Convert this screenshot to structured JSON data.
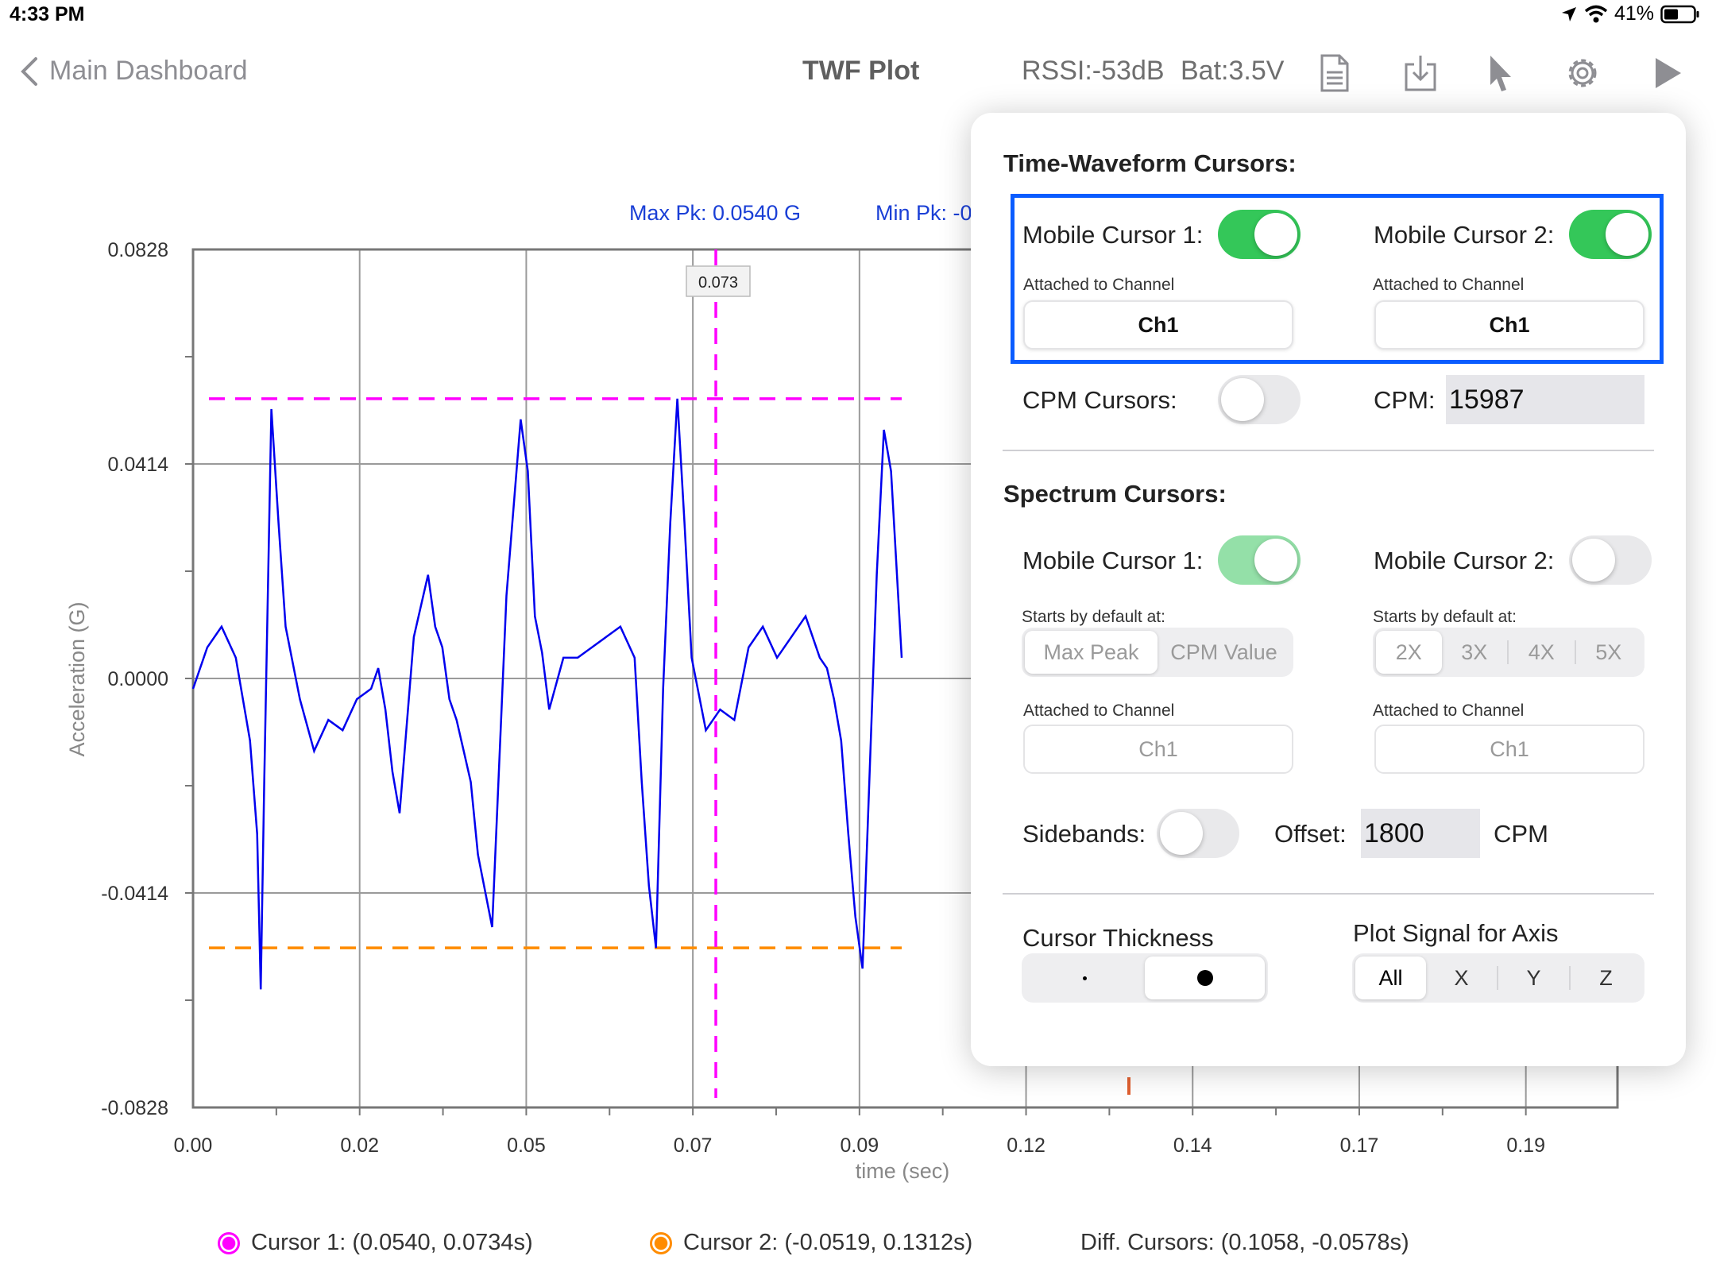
{
  "status_bar": {
    "time": "4:33 PM",
    "battery": "41%"
  },
  "nav": {
    "back_label": "Main Dashboard",
    "title": "TWF Plot",
    "rssi": "RSSI:-53dB",
    "battery": "Bat:3.5V",
    "tools": [
      "report-icon",
      "download-icon",
      "cursor-icon",
      "gear-icon",
      "play-icon"
    ]
  },
  "chart": {
    "max_pk": "Max Pk: 0.0540 G",
    "min_pk": "Min Pk: -0",
    "cursor_tag": "0.073",
    "y_axis_label": "Acceleration (G)",
    "x_axis_label": "time (sec)",
    "y_tick_labels": [
      "0.0828",
      "0.0414",
      "0.0000",
      "-0.0414",
      "-0.0828"
    ],
    "x_tick_labels": [
      "0.00",
      "0.02",
      "0.05",
      "0.07",
      "0.09",
      "0.12",
      "0.14",
      "0.17",
      "0.19"
    ]
  },
  "chart_data": {
    "type": "line",
    "xlabel": "time (sec)",
    "ylabel": "Acceleration (G)",
    "xlim": [
      0,
      0.2
    ],
    "ylim": [
      -0.0828,
      0.0828
    ],
    "series": [
      {
        "color": "#0000ee",
        "x": [
          0.0,
          0.002,
          0.004,
          0.006,
          0.008,
          0.009,
          0.0095,
          0.01,
          0.011,
          0.012,
          0.013,
          0.015,
          0.017,
          0.019,
          0.021,
          0.023,
          0.025,
          0.026,
          0.027,
          0.028,
          0.029,
          0.031,
          0.033,
          0.034,
          0.035,
          0.036,
          0.037,
          0.038,
          0.039,
          0.04,
          0.042,
          0.044,
          0.046,
          0.047,
          0.048,
          0.049,
          0.05,
          0.052,
          0.054,
          0.056,
          0.058,
          0.06,
          0.062,
          0.063,
          0.064,
          0.065,
          0.066,
          0.067,
          0.068,
          0.069,
          0.07,
          0.072,
          0.074,
          0.076,
          0.078,
          0.08,
          0.082,
          0.084,
          0.086,
          0.088,
          0.089,
          0.09,
          0.091,
          0.092,
          0.093,
          0.094,
          0.095,
          0.096,
          0.097,
          0.098,
          0.0995
        ],
        "y": [
          -0.002,
          0.006,
          0.01,
          0.004,
          -0.012,
          -0.03,
          -0.06,
          -0.02,
          0.052,
          0.03,
          0.01,
          -0.004,
          -0.014,
          -0.008,
          -0.01,
          -0.004,
          -0.002,
          0.002,
          -0.006,
          -0.018,
          -0.026,
          0.008,
          0.02,
          0.01,
          0.006,
          -0.004,
          -0.008,
          -0.014,
          -0.02,
          -0.034,
          -0.048,
          0.016,
          0.05,
          0.04,
          0.012,
          0.005,
          -0.006,
          0.004,
          0.004,
          0.006,
          0.008,
          0.01,
          0.004,
          -0.02,
          -0.04,
          -0.052,
          -0.002,
          0.03,
          0.054,
          0.03,
          0.004,
          -0.01,
          -0.006,
          -0.008,
          0.006,
          0.01,
          0.004,
          0.008,
          0.012,
          0.004,
          0.002,
          -0.004,
          -0.012,
          -0.03,
          -0.046,
          -0.056,
          -0.018,
          0.02,
          0.048,
          0.04,
          0.004
        ]
      }
    ],
    "cursors": {
      "horizontal_upper": 0.054,
      "horizontal_lower": -0.052,
      "vertical_time": 0.0734
    }
  },
  "legend": {
    "cursor1": "Cursor 1: (0.0540, 0.0734s)",
    "cursor2": "Cursor 2: (-0.0519, 0.1312s)",
    "diff": "Diff. Cursors: (0.1058, -0.0578s)",
    "cursor1_color": "#ff00ff",
    "cursor2_color": "#ff8c00"
  },
  "popover": {
    "twf_title": "Time-Waveform Cursors:",
    "mc1_label": "Mobile Cursor 1:",
    "mc2_label": "Mobile Cursor 2:",
    "attached_label": "Attached to Channel",
    "ch_value": "Ch1",
    "cpm_cursors_label": "CPM Cursors:",
    "cpm_label": "CPM:",
    "cpm_value": "15987",
    "spectrum_title": "Spectrum Cursors:",
    "starts_label": "Starts by default at:",
    "start_options_1": [
      "Max Peak",
      "CPM Value"
    ],
    "start_options_2": [
      "2X",
      "3X",
      "4X",
      "5X"
    ],
    "sidebands_label": "Sidebands:",
    "offset_label": "Offset:",
    "offset_value": "1800",
    "offset_unit": "CPM",
    "thickness_label": "Cursor Thickness",
    "thickness_options": [
      "thin",
      "thick"
    ],
    "plot_signal_label": "Plot Signal for Axis",
    "axis_options": [
      "All",
      "X",
      "Y",
      "Z"
    ]
  }
}
